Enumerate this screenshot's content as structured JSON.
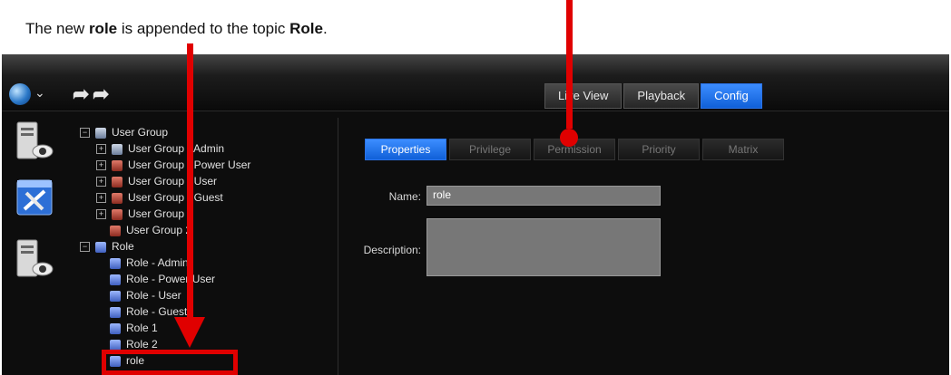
{
  "caption": {
    "before": "The new ",
    "bold1": "role",
    "middle": " is appended to the topic ",
    "bold2": "Role",
    "end": "."
  },
  "toolbar": {
    "globe_icon": "globe-icon",
    "modes": [
      "Live View",
      "Playback",
      "Config"
    ],
    "active_mode": "Config"
  },
  "sidebar_icons": [
    "server-camera-icon",
    "settings-tools-icon",
    "server-camera-icon"
  ],
  "tree": {
    "user_group": {
      "label": "User Group",
      "children": [
        "User Group - Admin",
        "User Group - Power User",
        "User Group - User",
        "User Group - Guest",
        "User Group 1",
        "User Group 2"
      ]
    },
    "role": {
      "label": "Role",
      "children": [
        "Role - Admin",
        "Role - Power User",
        "Role - User",
        "Role - Guest",
        "Role 1",
        "Role 2",
        "role"
      ]
    }
  },
  "main": {
    "tabs": [
      "Properties",
      "Privilege",
      "Permission",
      "Priority",
      "Matrix"
    ],
    "active_tab": "Properties",
    "name_label": "Name:",
    "name_value": "role",
    "description_label": "Description:",
    "description_value": ""
  },
  "colors": {
    "accent": "#1f6ff0",
    "annotation": "#e00000"
  }
}
